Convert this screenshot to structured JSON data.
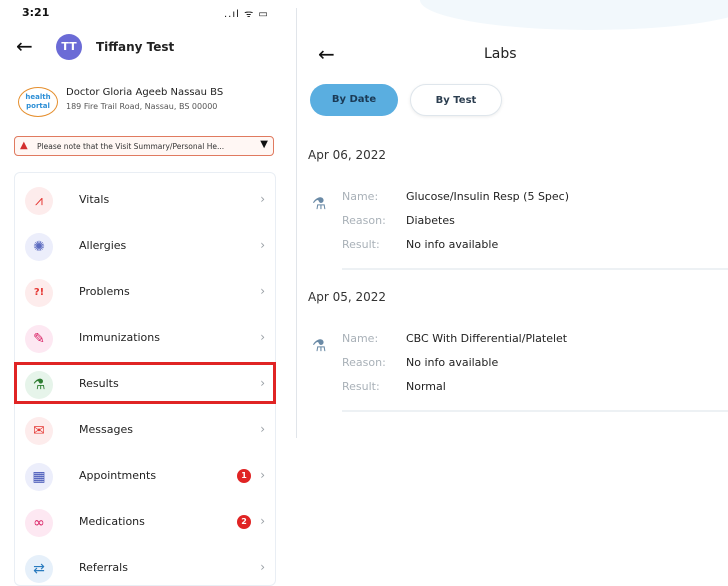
{
  "left": {
    "status": {
      "time": "3:21",
      "indicators": "..ıl ᯤ ▭"
    },
    "header": {
      "back_icon": "←",
      "avatar_initials": "TT",
      "patient_name": "Tiffany Test"
    },
    "doctor": {
      "logo_text": "health portal",
      "name": "Doctor Gloria Ageeb Nassau BS",
      "address": "189 Fire Trail Road, Nassau, BS 00000"
    },
    "notice": {
      "text": "Please note that the Visit Summary/Personal He...",
      "chevron": "▼"
    },
    "menu": [
      {
        "label": "Vitals",
        "icon": "heartbeat-icon",
        "glyph": "⩘",
        "color": "#e53935",
        "bg": "#fdecec",
        "badge": ""
      },
      {
        "label": "Allergies",
        "icon": "allergy-icon",
        "glyph": "✺",
        "color": "#5c6bc0",
        "bg": "#eceefb",
        "badge": ""
      },
      {
        "label": "Problems",
        "icon": "problems-icon",
        "glyph": "?!",
        "color": "#e53935",
        "bg": "#fdecec",
        "badge": ""
      },
      {
        "label": "Immunizations",
        "icon": "syringe-icon",
        "glyph": "✎",
        "color": "#d81b60",
        "bg": "#fde8f2",
        "badge": ""
      },
      {
        "label": "Results",
        "icon": "flask-icon",
        "glyph": "⚗",
        "color": "#2e7d32",
        "bg": "#e6f4ea",
        "badge": ""
      },
      {
        "label": "Messages",
        "icon": "envelope-icon",
        "glyph": "✉",
        "color": "#e53935",
        "bg": "#fdecec",
        "badge": ""
      },
      {
        "label": "Appointments",
        "icon": "calendar-icon",
        "glyph": "▦",
        "color": "#3f51b5",
        "bg": "#eceefb",
        "badge": "1"
      },
      {
        "label": "Medications",
        "icon": "pill-icon",
        "glyph": "∞",
        "color": "#d81b60",
        "bg": "#fde8f2",
        "badge": "2"
      },
      {
        "label": "Referrals",
        "icon": "referral-icon",
        "glyph": "⇄",
        "color": "#2a7bbf",
        "bg": "#e6f0fa",
        "badge": ""
      }
    ],
    "arrow": "›"
  },
  "right": {
    "back_icon": "←",
    "title": "Labs",
    "segments": {
      "by_date": "By Date",
      "by_test": "By Test"
    },
    "groups": [
      {
        "date": "Apr 06, 2022",
        "name_label": "Name:",
        "name": "Glucose/Insulin Resp (5 Spec)",
        "reason_label": "Reason:",
        "reason": "Diabetes",
        "result_label": "Result:",
        "result": "No info available"
      },
      {
        "date": "Apr 05, 2022",
        "name_label": "Name:",
        "name": "CBC With Differential/Platelet",
        "reason_label": "Reason:",
        "reason": "No info available",
        "result_label": "Result:",
        "result": "Normal"
      }
    ]
  }
}
